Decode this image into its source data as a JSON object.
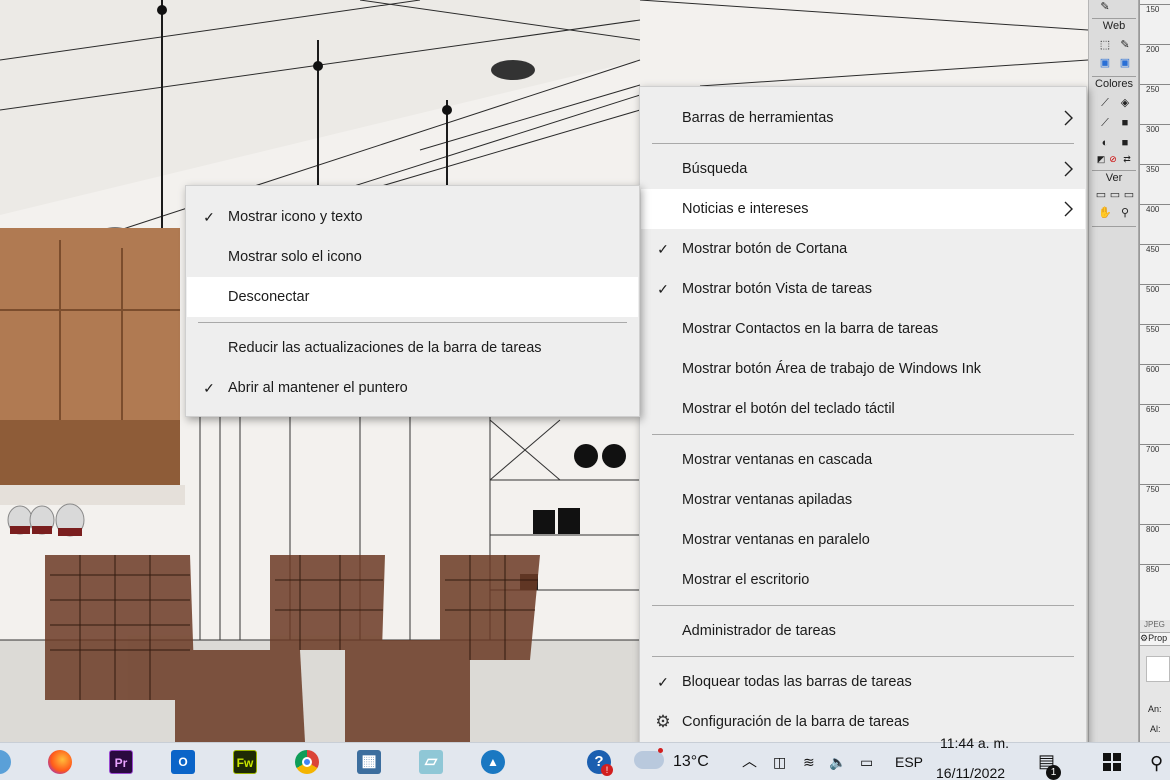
{
  "main_menu": {
    "items": [
      {
        "label": "Barras de herramientas",
        "checked": false,
        "submenu": true
      },
      {
        "label": "Búsqueda",
        "checked": false,
        "submenu": true
      },
      {
        "label": "Noticias e intereses",
        "checked": false,
        "submenu": true,
        "highlighted": true
      },
      {
        "label": "Mostrar botón de Cortana",
        "checked": true
      },
      {
        "label": "Mostrar botón Vista de tareas",
        "checked": true
      },
      {
        "label": "Mostrar Contactos en la barra de tareas",
        "checked": false
      },
      {
        "label": "Mostrar botón Área de trabajo de Windows Ink",
        "checked": false
      },
      {
        "label": "Mostrar el botón del teclado táctil",
        "checked": false
      },
      {
        "label": "Mostrar ventanas en cascada",
        "checked": false
      },
      {
        "label": "Mostrar ventanas apiladas",
        "checked": false
      },
      {
        "label": "Mostrar ventanas en paralelo",
        "checked": false
      },
      {
        "label": "Mostrar el escritorio",
        "checked": false
      },
      {
        "label": "Administrador de tareas",
        "checked": false
      },
      {
        "label": "Bloquear todas las barras de tareas",
        "checked": true
      },
      {
        "label": "Configuración de la barra de tareas",
        "icon": "gear-icon"
      }
    ]
  },
  "sub_menu": {
    "items": [
      {
        "label": "Mostrar icono y texto",
        "checked": true
      },
      {
        "label": "Mostrar solo el icono",
        "checked": false
      },
      {
        "label": "Desconectar",
        "checked": false,
        "highlighted": true
      },
      {
        "label": "Reducir las actualizaciones de la barra de tareas",
        "checked": false
      },
      {
        "label": "Abrir al mantener el puntero",
        "checked": true
      }
    ]
  },
  "palette": {
    "web_label": "Web",
    "colors_label": "Colores",
    "view_label": "Ver",
    "ruler_ticks": [
      "150",
      "200",
      "250",
      "300",
      "350",
      "400",
      "450",
      "500",
      "550",
      "600",
      "650",
      "700",
      "750",
      "800",
      "850"
    ],
    "panel_tab": "JPEG",
    "panel_props": "Prop",
    "panel_an": "An:",
    "panel_al": "Al:"
  },
  "taskbar": {
    "apps": [
      {
        "name": "firefox-icon",
        "glyph": "",
        "bg": "#ff7a1a",
        "fg": "#ffffff"
      },
      {
        "name": "premiere-icon",
        "glyph": "Pr",
        "bg": "#2a0a3f",
        "fg": "#e9a3ff"
      },
      {
        "name": "outlook-icon",
        "glyph": "O",
        "bg": "#0a64c8",
        "fg": "#ffffff"
      },
      {
        "name": "fireworks-icon",
        "glyph": "Fw",
        "bg": "#1f2b05",
        "fg": "#c9e600"
      },
      {
        "name": "chrome-icon",
        "glyph": "",
        "bg": "#ffffff",
        "fg": "#ffffff"
      },
      {
        "name": "calculator-icon",
        "glyph": "▦",
        "bg": "#3c6e9e",
        "fg": "#ffffff"
      },
      {
        "name": "notepad-icon",
        "glyph": "▱",
        "bg": "#8fc7d6",
        "fg": "#ffffff"
      },
      {
        "name": "triangle-app-icon",
        "glyph": "▲",
        "bg": "#1a78c2",
        "fg": "#ffffff"
      },
      {
        "name": "help-icon",
        "glyph": "?",
        "bg": "#1b5fb0",
        "fg": "#ffffff"
      }
    ],
    "weather_temp": "13°C",
    "language": "ESP",
    "time": "11:44 a. m.",
    "date": "16/11/2022",
    "notification_count": "1",
    "colors": {
      "accent": "#0a64c8"
    }
  }
}
